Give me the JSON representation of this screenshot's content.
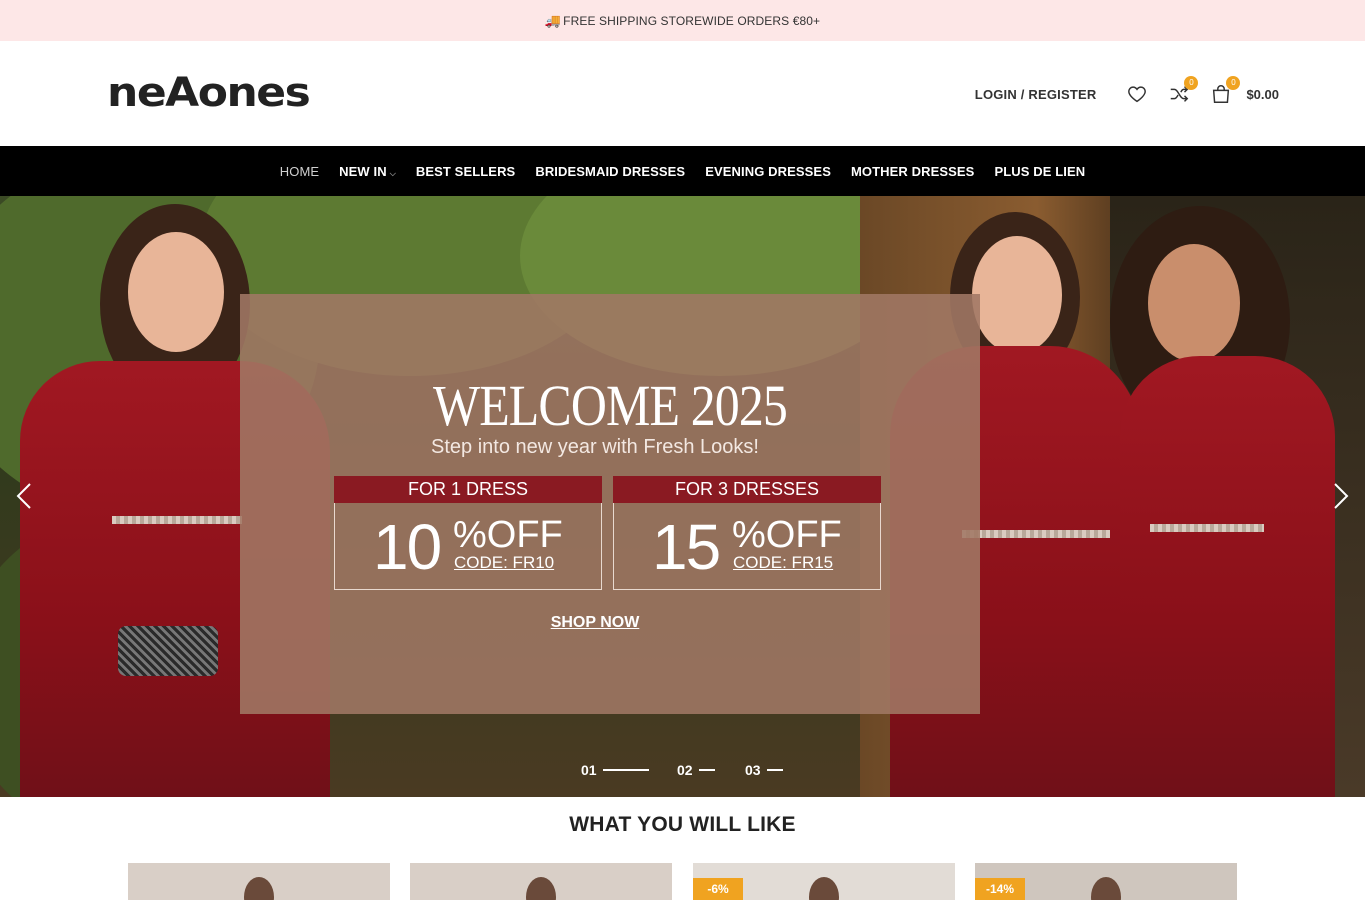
{
  "promo": {
    "text": "FREE SHIPPING STOREWIDE ORDERS €80+",
    "icon": "truck-icon"
  },
  "header": {
    "logo": "neAones",
    "login_label": "LOGIN / REGISTER",
    "wishlist_icon": "heart-icon",
    "compare_icon": "shuffle-icon",
    "compare_count": "0",
    "cart_icon": "shopping-bag-icon",
    "cart_count": "0",
    "cart_total": "$0.00"
  },
  "nav": {
    "items": [
      {
        "label": "HOME",
        "active": true
      },
      {
        "label": "NEW IN",
        "has_dropdown": true
      },
      {
        "label": "BEST SELLERS"
      },
      {
        "label": "BRIDESMAID DRESSES"
      },
      {
        "label": "EVENING DRESSES"
      },
      {
        "label": "MOTHER DRESSES"
      },
      {
        "label": "PLUS DE LIEN"
      }
    ]
  },
  "hero": {
    "title": "WELCOME 2025",
    "subtitle": "Step into new year with Fresh Looks!",
    "offers": [
      {
        "head": "FOR 1 DRESS",
        "number": "10",
        "pct": "%OFF",
        "code": "CODE: FR10"
      },
      {
        "head": "FOR 3 DRESSES",
        "number": "15",
        "pct": "%OFF",
        "code": "CODE: FR15"
      }
    ],
    "cta": "SHOP NOW",
    "slides": [
      "01",
      "02",
      "03"
    ],
    "active_slide": 0
  },
  "section": {
    "title": "WHAT YOU WILL LIKE",
    "products": [
      {
        "badge": ""
      },
      {
        "badge": ""
      },
      {
        "badge": "-6%"
      },
      {
        "badge": "-14%"
      }
    ]
  },
  "colors": {
    "promo_bg": "#fde7e7",
    "nav_bg": "#000000",
    "badge": "#f0a320",
    "offer_head": "#8a1a22"
  }
}
